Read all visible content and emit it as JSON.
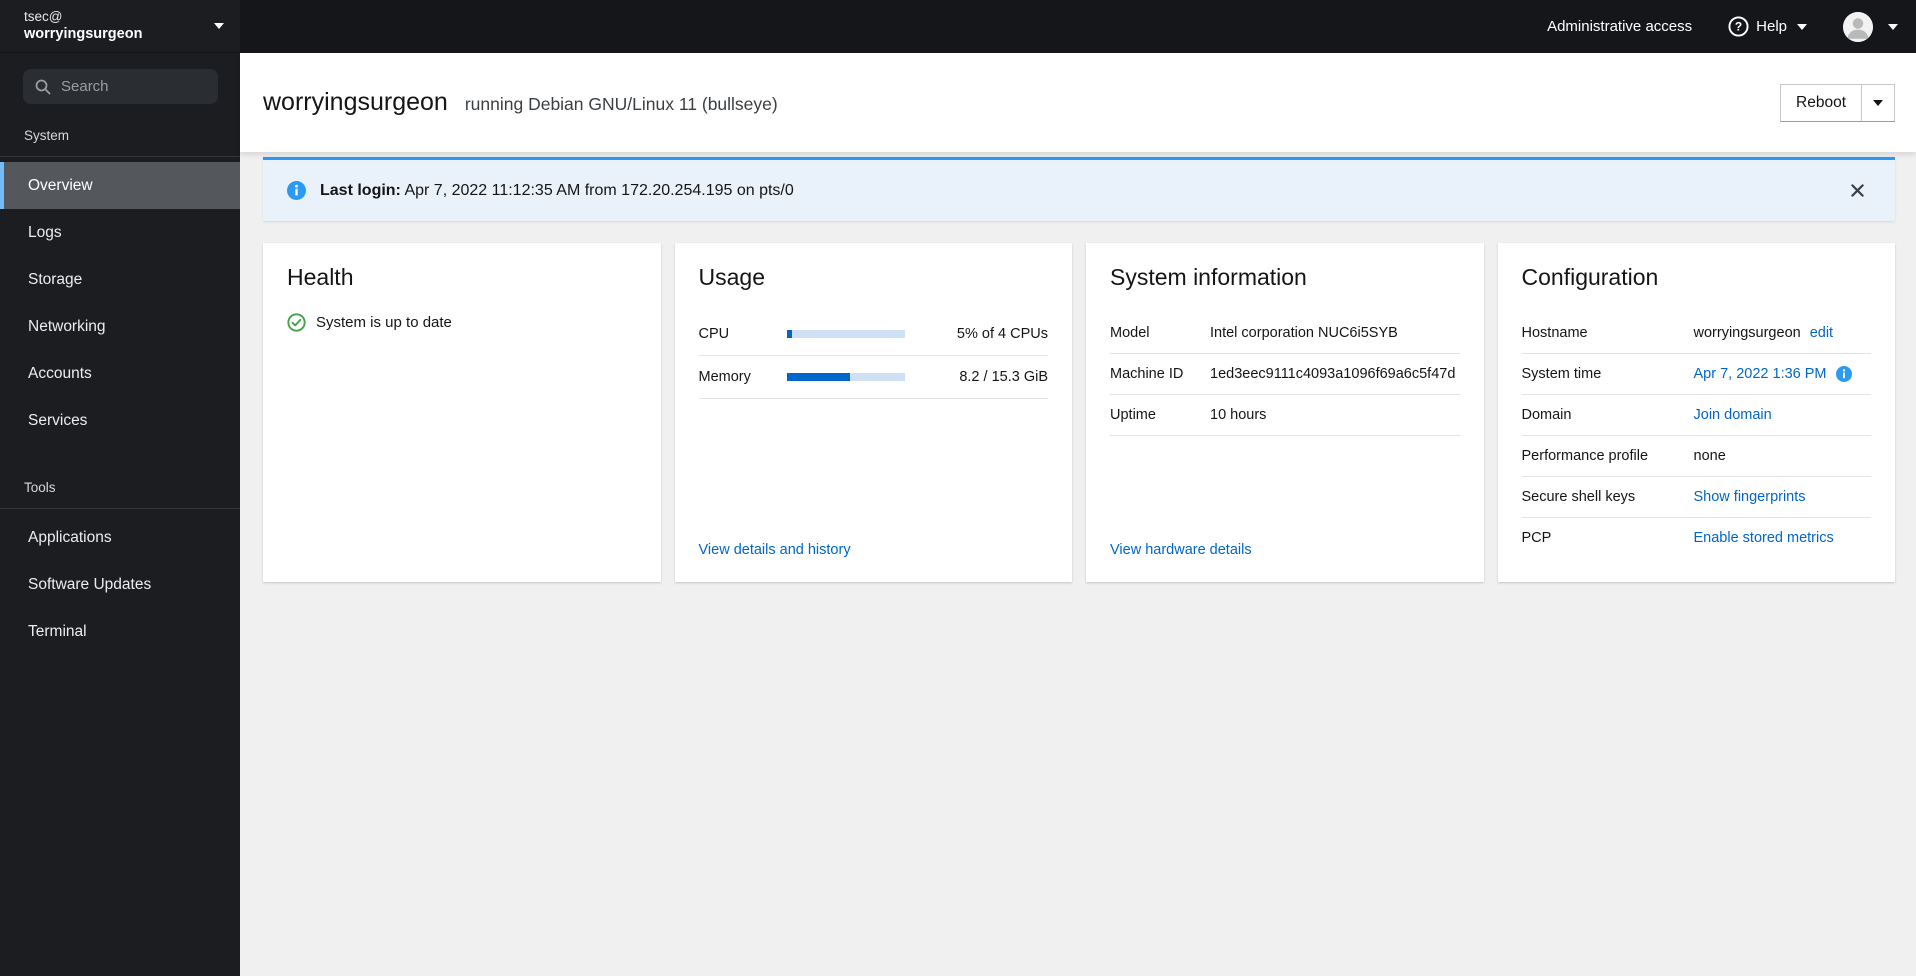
{
  "colors": {
    "link_blue": "#0066cc",
    "alert_info_blue": "#2b9af3",
    "success_green": "#45a148",
    "progress_fill": "#0066cc",
    "progress_track": "#cfe0f5",
    "nav_active_indicator": "#73bcf7"
  },
  "masthead": {
    "admin_access_label": "Administrative access",
    "help_label": "Help"
  },
  "sidebar": {
    "user": "tsec@",
    "host": "worryingsurgeon",
    "search_placeholder": "Search",
    "sections": [
      {
        "label": "System",
        "items": [
          {
            "label": "Overview",
            "active": true
          },
          {
            "label": "Logs"
          },
          {
            "label": "Storage"
          },
          {
            "label": "Networking"
          },
          {
            "label": "Accounts"
          },
          {
            "label": "Services"
          }
        ]
      },
      {
        "label": "Tools",
        "items": [
          {
            "label": "Applications"
          },
          {
            "label": "Software Updates"
          },
          {
            "label": "Terminal"
          }
        ]
      }
    ]
  },
  "header": {
    "hostname": "worryingsurgeon",
    "subtitle": "running Debian GNU/Linux 11 (bullseye)",
    "reboot_label": "Reboot"
  },
  "alert": {
    "title": "Last login:",
    "message": "Apr 7, 2022 11:12:35 AM from 172.20.254.195 on pts/0"
  },
  "cards": {
    "health": {
      "title": "Health",
      "status": "System is up to date"
    },
    "usage": {
      "title": "Usage",
      "rows": [
        {
          "label": "CPU",
          "percent": 5,
          "value": "5% of 4 CPUs"
        },
        {
          "label": "Memory",
          "percent": 54,
          "value": "8.2 / 15.3 GiB"
        }
      ],
      "link": "View details and history"
    },
    "system_info": {
      "title": "System information",
      "rows": [
        {
          "label": "Model",
          "value": "Intel corporation NUC6i5SYB"
        },
        {
          "label": "Machine ID",
          "value": "1ed3eec9111c4093a1096f69a6c5f47d"
        },
        {
          "label": "Uptime",
          "value": "10 hours"
        }
      ],
      "link": "View hardware details"
    },
    "configuration": {
      "title": "Configuration",
      "rows": [
        {
          "label": "Hostname",
          "value": "worryingsurgeon",
          "link": "edit"
        },
        {
          "label": "System time",
          "link": "Apr 7, 2022 1:36 PM"
        },
        {
          "label": "Domain",
          "link": "Join domain"
        },
        {
          "label": "Performance profile",
          "value": "none"
        },
        {
          "label": "Secure shell keys",
          "link": "Show fingerprints"
        },
        {
          "label": "PCP",
          "link": "Enable stored metrics"
        }
      ]
    }
  }
}
